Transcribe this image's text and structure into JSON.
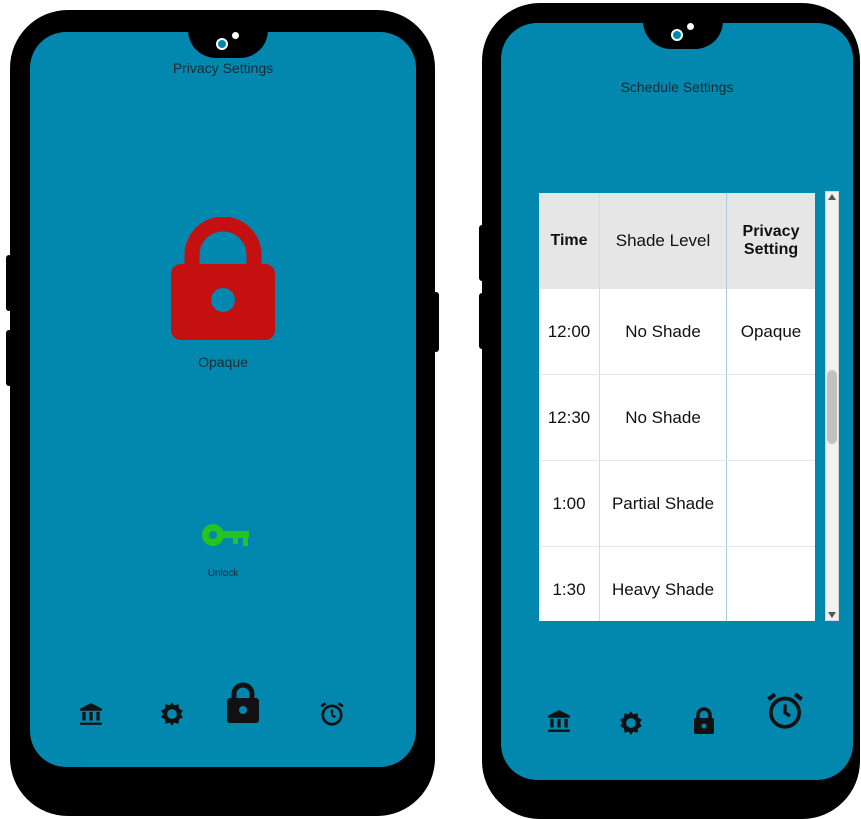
{
  "left_phone": {
    "title": "Privacy Settings",
    "lock_label": "Opaque",
    "unlock_label": "Unlock",
    "nav": [
      "bank-icon",
      "gear-icon",
      "lock-icon",
      "alarm-clock-icon"
    ]
  },
  "right_phone": {
    "title": "Schedule Settings",
    "table": {
      "headers": [
        "Time",
        "Shade Level",
        "Privacy Setting"
      ],
      "rows": [
        [
          "12:00",
          "No Shade",
          "Opaque"
        ],
        [
          "12:30",
          "No Shade",
          ""
        ],
        [
          "1:00",
          "Partial Shade",
          ""
        ],
        [
          "1:30",
          "Heavy Shade",
          ""
        ]
      ]
    },
    "nav": [
      "bank-icon",
      "gear-icon",
      "lock-icon",
      "alarm-clock-icon"
    ]
  },
  "colors": {
    "screen": "#0287ae",
    "lock_red": "#c41010",
    "key_green": "#25c41f",
    "icon_dark": "#111111"
  }
}
